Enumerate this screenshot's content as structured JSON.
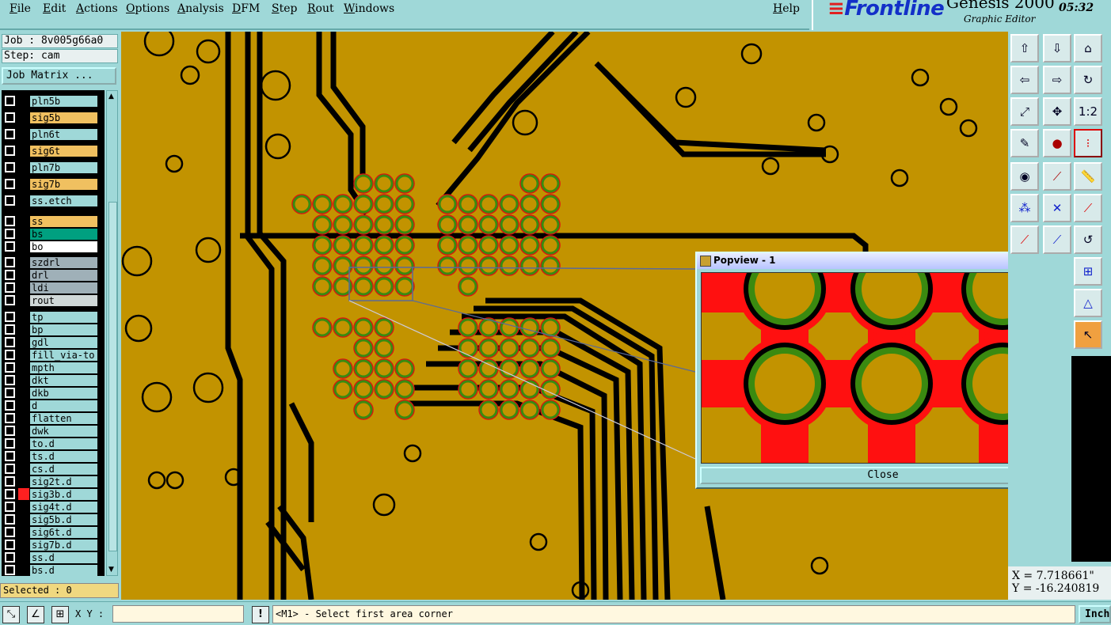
{
  "menubar": {
    "items": [
      "File",
      "Edit",
      "Actions",
      "Options",
      "Analysis",
      "DFM",
      "Step",
      "Rout",
      "Windows"
    ],
    "help": "Help"
  },
  "brand": {
    "logo": "Frontline",
    "product": "Genesis 2000",
    "subtitle": "Graphic Editor",
    "time": "05:32"
  },
  "job": {
    "job_line": "Job : 8v005g66a0",
    "step_line": "Step: cam",
    "matrix_button": "Job Matrix ..."
  },
  "layers": [
    {
      "name": "pln5b",
      "color": "#9fd8d8"
    },
    {
      "name": "sig5b",
      "color": "#f0c060"
    },
    {
      "name": "pln6t",
      "color": "#9fd8d8"
    },
    {
      "name": "sig6t",
      "color": "#f0c060"
    },
    {
      "name": "pln7b",
      "color": "#9fd8d8"
    },
    {
      "name": "sig7b",
      "color": "#f0c060"
    },
    {
      "name": "ss.etch",
      "color": "#9fd8d8"
    },
    {
      "name": "ss",
      "color": "#f0c060"
    },
    {
      "name": "bs",
      "color": "#00a080"
    },
    {
      "name": "bo",
      "color": "#ffffff"
    },
    {
      "name": "szdrl",
      "color": "#9fb0b8"
    },
    {
      "name": "drl",
      "color": "#9fb0b8"
    },
    {
      "name": "ldi",
      "color": "#9fb0b8"
    },
    {
      "name": "rout",
      "color": "#d0d8d8"
    },
    {
      "name": "tp",
      "color": "#9fd8d8"
    },
    {
      "name": "bp",
      "color": "#9fd8d8"
    },
    {
      "name": "gdl",
      "color": "#9fd8d8"
    },
    {
      "name": "fill_via-to",
      "color": "#9fd8d8"
    },
    {
      "name": "mpth",
      "color": "#9fd8d8"
    },
    {
      "name": "dkt",
      "color": "#9fd8d8"
    },
    {
      "name": "dkb",
      "color": "#9fd8d8"
    },
    {
      "name": "d",
      "color": "#9fd8d8"
    },
    {
      "name": "flatten",
      "color": "#9fd8d8"
    },
    {
      "name": "dwk",
      "color": "#9fd8d8"
    },
    {
      "name": "to.d",
      "color": "#9fd8d8"
    },
    {
      "name": "ts.d",
      "color": "#9fd8d8"
    },
    {
      "name": "cs.d",
      "color": "#9fd8d8"
    },
    {
      "name": "sig2t.d",
      "color": "#9fd8d8"
    },
    {
      "name": "sig3b.d",
      "color": "#9fd8d8",
      "marker": "#ff2020"
    },
    {
      "name": "sig4t.d",
      "color": "#9fd8d8"
    },
    {
      "name": "sig5b.d",
      "color": "#9fd8d8"
    },
    {
      "name": "sig6t.d",
      "color": "#9fd8d8"
    },
    {
      "name": "sig7b.d",
      "color": "#9fd8d8"
    },
    {
      "name": "ss.d",
      "color": "#9fd8d8"
    },
    {
      "name": "bs.d",
      "color": "#9fd8d8"
    }
  ],
  "selected": "Selected : 0",
  "popview": {
    "title": "Popview - 1",
    "close_label": "Close"
  },
  "coords": {
    "x": "X = 7.718661\"",
    "y": "Y = -16.240819"
  },
  "status": {
    "xy_label": "X Y :",
    "xy_value": "",
    "message": "<M1> - Select first area corner",
    "units": "Inch"
  },
  "colors": {
    "board": "#c29300",
    "trace": "#000000",
    "pad_outline": "#e01010",
    "pad_ring": "#3a8a10",
    "ui_bg": "#9fd8d8"
  }
}
